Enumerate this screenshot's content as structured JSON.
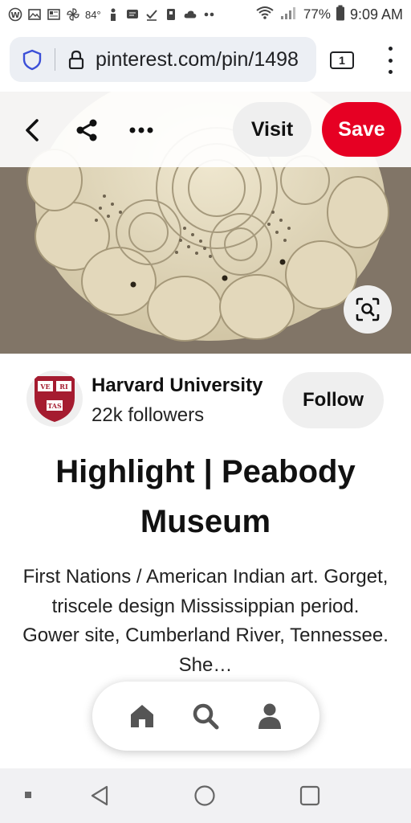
{
  "status_bar": {
    "temperature": "84°",
    "battery_percent": "77%",
    "time": "9:09 AM",
    "icons": [
      "wordpress-icon",
      "image-icon",
      "news-icon",
      "pinwheel-icon",
      "person-icon",
      "message-icon",
      "check-icon",
      "clipboard-icon",
      "cloud-icon",
      "more-dots-icon",
      "wifi-icon",
      "signal-icon",
      "battery-icon"
    ]
  },
  "browser": {
    "url": "pinterest.com/pin/1498",
    "tab_count": "1"
  },
  "pin": {
    "visit_label": "Visit",
    "save_label": "Save",
    "creator": {
      "name": "Harvard University",
      "followers": "22k followers",
      "shield_text": [
        "VE",
        "RI",
        "TAS"
      ]
    },
    "title": "Highlight | Peabody Museum",
    "description": "First Nations / American Indian art. Gorget, triscele design Mississippian period. Gower site, Cumberland River, Tennessee. She…",
    "follow_label": "Follow"
  },
  "colors": {
    "save_red": "#e60023",
    "harvard_crimson": "#a51c30",
    "neutral_button": "#efefef"
  },
  "bottom_nav": [
    "home-icon",
    "search-icon",
    "profile-icon"
  ],
  "android_nav": [
    "back-icon",
    "home-circle-icon",
    "recents-icon"
  ]
}
